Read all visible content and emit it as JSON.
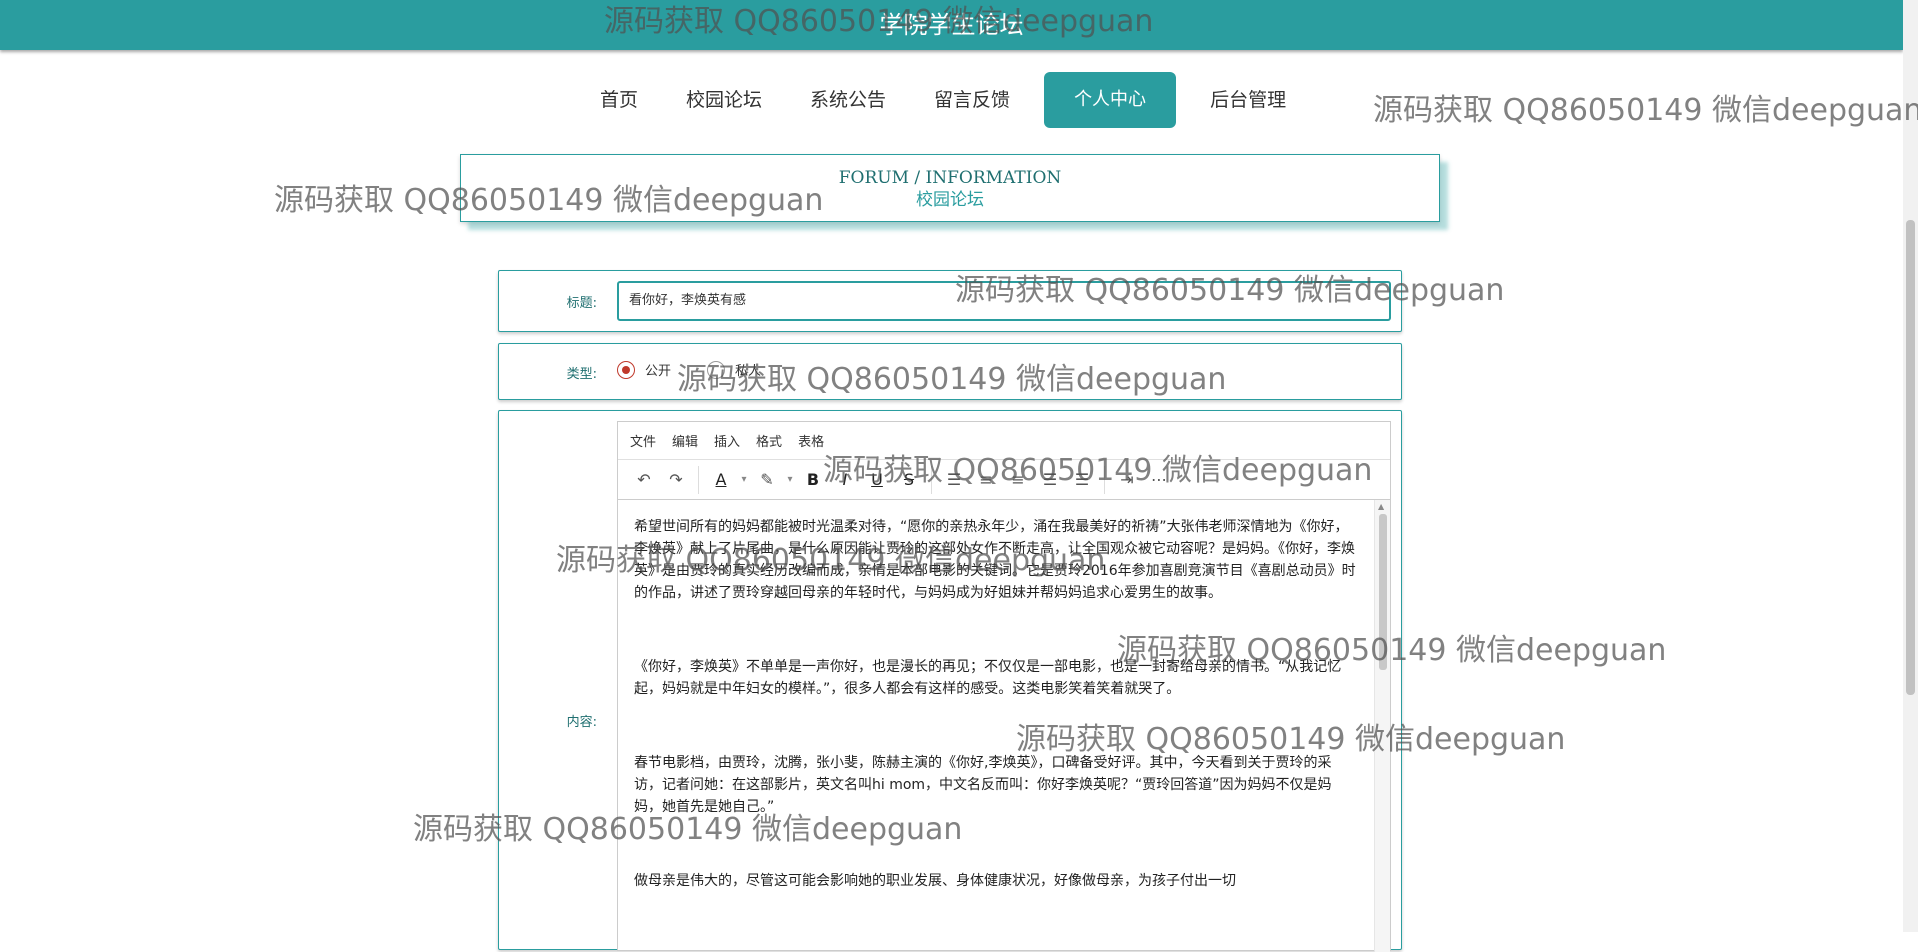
{
  "header": {
    "title": "学院学生论坛"
  },
  "nav": {
    "items": [
      "首页",
      "校园论坛",
      "系统公告",
      "留言反馈",
      "个人中心",
      "后台管理"
    ],
    "active": "个人中心"
  },
  "section": {
    "title_en": "FORUM / INFORMATION",
    "title_cn": "校园论坛"
  },
  "form": {
    "title_label": "标题:",
    "title_value": "看你好，李焕英有感",
    "type_label": "类型:",
    "type_options": [
      "公开",
      "私人"
    ],
    "type_selected": "公开",
    "content_label": "内容:"
  },
  "editor": {
    "menu": [
      "文件",
      "编辑",
      "插入",
      "格式",
      "表格"
    ],
    "paragraphs": [
      "希望世间所有的妈妈都能被时光温柔对待，“愿你的亲热永年少，涌在我最美好的祈祷”大张伟老师深情地为《你好，李焕英》献上了片尾曲，是什么原因能让贾玲的这部处女作不断走高，让全国观众被它动容呢？是妈妈。《你好，李焕英》是由贾玲的真实经历改编而成，亲情是本部电影的关键词。它是贾玲2016年参加喜剧竞演节目《喜剧总动员》时的作品，讲述了贾玲穿越回母亲的年轻时代，与妈妈成为好姐妹并帮妈妈追求心爱男生的故事。",
      "《你好，李焕英》不单单是一声你好，也是漫长的再见；不仅仅是一部电影，也是一封寄给母亲的情书。“从我记忆起，妈妈就是中年妇女的模样。”，很多人都会有这样的感受。这类电影笑着笑着就哭了。",
      "春节电影档，由贾玲，沈腾，张小斐，陈赫主演的《你好,李焕英》，口碑备受好评。其中，今天看到关于贾玲的采访，记者问她：在这部影片，英文名叫hi mom，中文名反而叫：你好李焕英呢？“贾玲回答道”因为妈妈不仅是妈妈，她首先是她自己。”",
      "做母亲是伟大的，尽管这可能会影响她的职业发展、身体健康状况，好像做母亲，为孩子付出一切"
    ]
  },
  "watermark": {
    "text": "源码获取 QQ86050149 微信deepguan"
  },
  "colors": {
    "brand": "#2a9d9f",
    "radio_checked": "#c0392b"
  }
}
